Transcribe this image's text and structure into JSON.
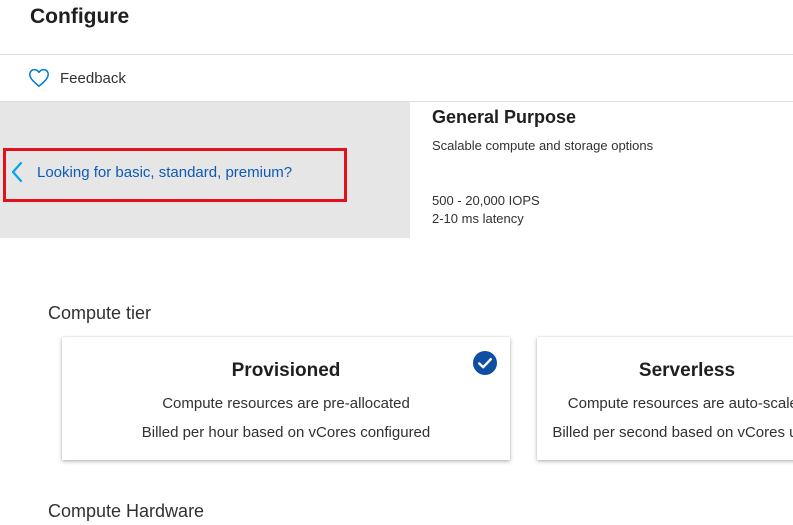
{
  "header": {
    "title": "Configure"
  },
  "toolbar": {
    "feedback_label": "Feedback",
    "feedback_icon": "heart-outline-icon"
  },
  "tier_panel": {
    "basic_link_label": "Looking for basic, standard, premium?",
    "basic_link_icon": "chevron-left-icon",
    "highlight_color": "#e3111b"
  },
  "selected_tier": {
    "name": "General Purpose",
    "description": "Scalable compute and storage options",
    "iops": "500 - 20,000 IOPS",
    "latency": "2-10 ms latency"
  },
  "compute_tier": {
    "label": "Compute tier",
    "cards": [
      {
        "title": "Provisioned",
        "line1": "Compute resources are pre-allocated",
        "line2": "Billed per hour based on vCores configured",
        "selected": true,
        "icon": "checkmark-circle-icon"
      },
      {
        "title": "Serverless",
        "line1": "Compute resources are auto-scaled",
        "line2": "Billed per second based on vCores used",
        "selected": false
      }
    ]
  },
  "compute_hardware": {
    "label": "Compute Hardware"
  },
  "colors": {
    "accent": "#0f5ab5",
    "check_fill": "#0f4ea3",
    "panel_bg": "#e6e6e6",
    "link_chevron": "#00a4ef"
  }
}
